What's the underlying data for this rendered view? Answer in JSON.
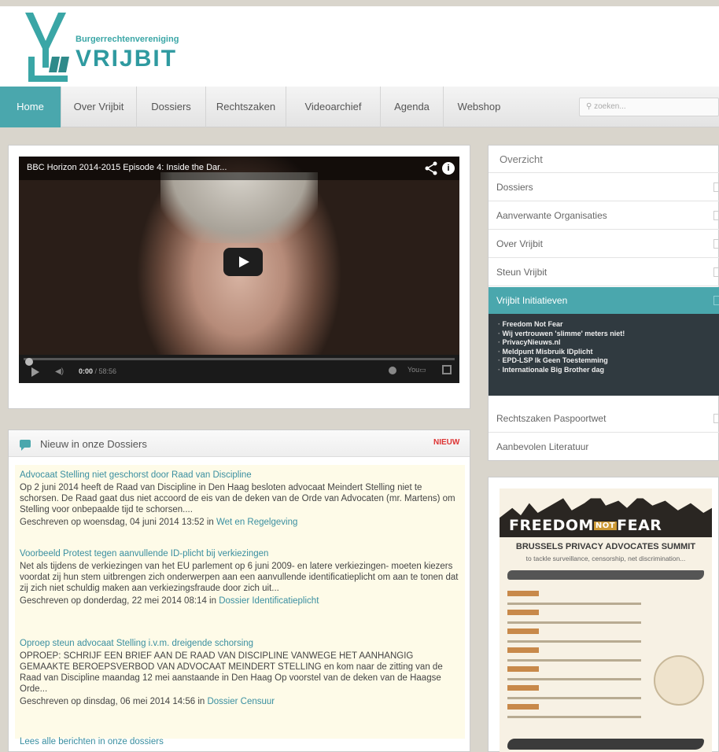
{
  "header": {
    "logo_small": "Burgerrechtenvereniging",
    "logo_big": "VRIJBIT"
  },
  "nav": {
    "items": [
      "Home",
      "Over Vrijbit",
      "Dossiers",
      "Rechtszaken",
      "Videoarchief",
      "Agenda",
      "Webshop"
    ],
    "active": "Home",
    "search_placeholder": "zoeken..."
  },
  "video": {
    "title": "BBC Horizon 2014-2015 Episode 4: Inside the Dar...",
    "time_current": "0:00",
    "time_total": " / 58:56",
    "info_glyph": "i"
  },
  "news": {
    "title": "Nieuw in onze Dossiers",
    "badge": "NIEUW",
    "read_all": "Lees alle berichten in onze dossiers",
    "articles": [
      {
        "title": "Advocaat Stelling niet geschorst door Raad van Discipline",
        "text": "Op 2 juni 2014 heeft de Raad van Discipline in Den Haag besloten advocaat Meindert Stelling niet te schorsen. De Raad gaat dus niet accoord de eis van de deken van de Orde van Advocaten (mr. Martens) om Stelling voor onbepaalde tijd te schorsen....",
        "meta": "Geschreven op woensdag, 04 juni 2014 13:52 in ",
        "category": "Wet en Regelgeving"
      },
      {
        "title": "Voorbeeld Protest tegen aanvullende ID-plicht bij verkiezingen",
        "text": "Net als tijdens de verkiezingen van het EU parlement op 6 juni 2009- en latere verkiezingen- moeten kiezers voordat zij hun stem uitbrengen zich onderwerpen aan een aanvullende identificatieplicht om aan te tonen dat zij zich niet schuldig maken aan verkiezingsfraude door zich uit...",
        "meta": "Geschreven op donderdag, 22 mei 2014 08:14 in ",
        "category": "Dossier Identificatieplicht"
      },
      {
        "title": "Oproep steun advocaat Stelling i.v.m. dreigende schorsing",
        "text": "OPROEP: SCHRIJF EEN BRIEF AAN DE RAAD VAN DISCIPLINE VANWEGE HET AANHANGIG GEMAAKTE BEROEPSVERBOD VAN ADVOCAAT MEINDERT STELLING en kom naar de zitting van de Raad van Discipline maandag 12 mei aanstaande in Den Haag Op voorstel van de deken van de Haagse Orde...",
        "meta": "Geschreven op dinsdag, 06 mei 2014 14:56 in ",
        "category": "Dossier Censuur"
      }
    ]
  },
  "sidebar": {
    "items": [
      "Overzicht",
      "Dossiers",
      "Aanverwante Organisaties",
      "Over Vrijbit",
      "Steun Vrijbit",
      "Vrijbit Initiatieven",
      "Rechtszaken Paspoortwet",
      "Aanbevolen Literatuur"
    ],
    "active": "Vrijbit Initiatieven",
    "submenu": [
      "Freedom Not Fear",
      "Wij vertrouwen 'slimme' meters niet!",
      "PrivacyNieuws.nl",
      "Meldpunt Misbruik IDplicht",
      "EPD-LSP Ik Geen Toestemming",
      "Internationale Big Brother dag"
    ]
  },
  "poster": {
    "title_part1": "FREEDOM",
    "title_not": "NOT",
    "title_part2": "FEAR",
    "summit": "BRUSSELS PRIVACY ADVOCATES SUMMIT",
    "subtitle": "to tackle surveillance, censorship, net discrimination..."
  },
  "colors": {
    "accent": "#4aa7ad",
    "link": "#3a8fa0",
    "badge": "#dd3333",
    "submenu_bg": "#303a40"
  }
}
